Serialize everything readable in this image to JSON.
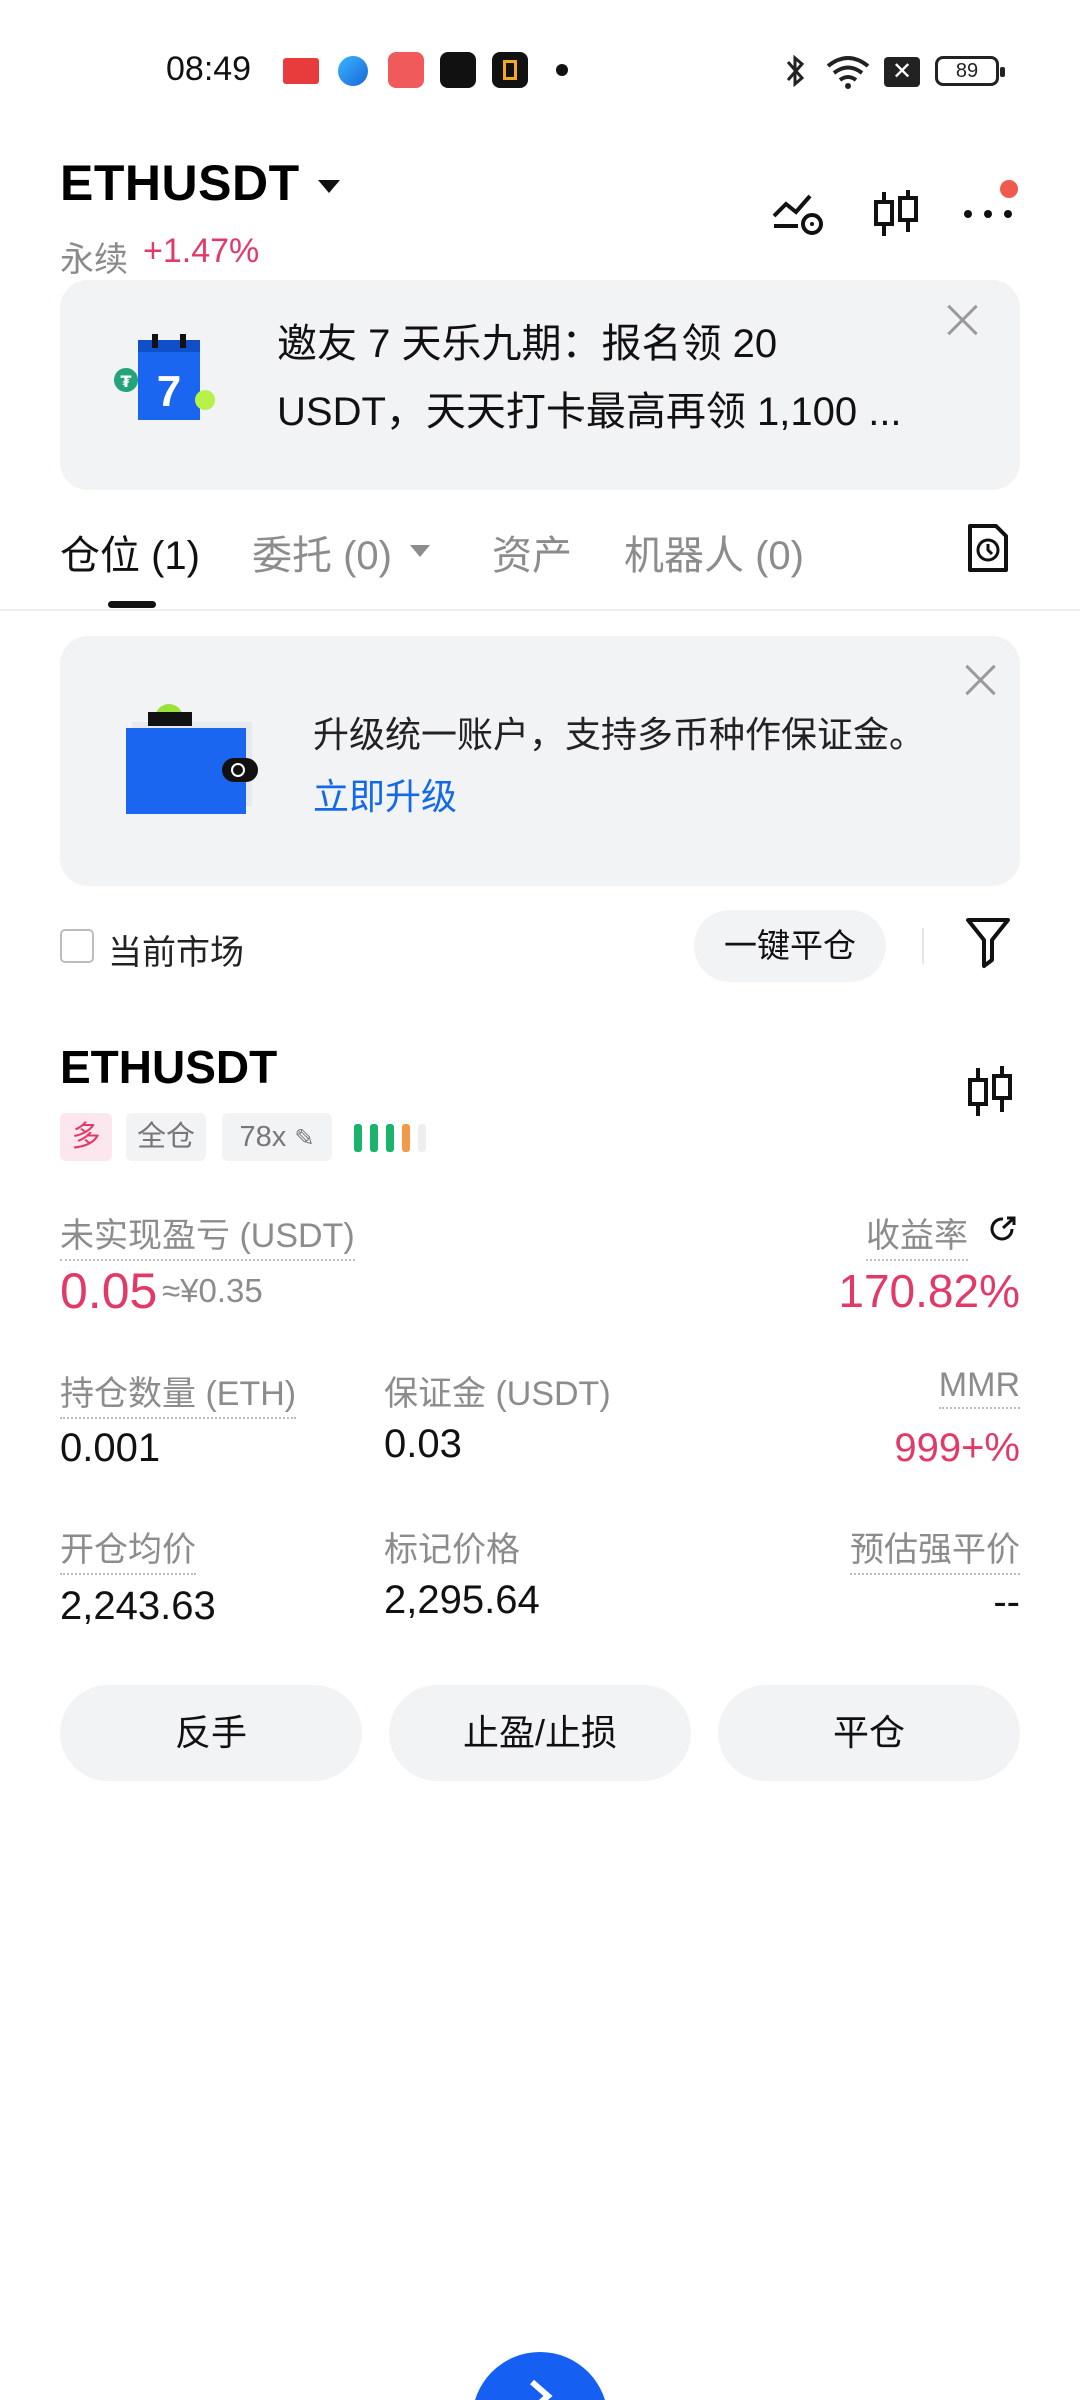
{
  "status_bar": {
    "time": "08:49",
    "battery": "89",
    "icons": [
      "toutiao-icon",
      "browser-icon",
      "video-app-icon",
      "tiktok-icon",
      "app-icon",
      "bluetooth-icon",
      "wifi-icon",
      "close-box-icon",
      "battery-icon"
    ]
  },
  "header": {
    "symbol": "ETHUSDT",
    "contract_type": "永续",
    "change": "+1.47%",
    "icons": [
      "trade-chart-icon",
      "candlestick-icon",
      "more-icon"
    ]
  },
  "promo_banner": {
    "text": "邀友 7 天乐九期：报名领 20 USDT，天天打卡最高再领 1,100 ...",
    "calendar_number": "7",
    "tether_symbol": "₮"
  },
  "tabs": [
    {
      "label": "仓位 (1)",
      "active": true
    },
    {
      "label": "委托 (0)",
      "active": false
    },
    {
      "label": "资产",
      "active": false
    },
    {
      "label": "机器人 (0)",
      "active": false
    }
  ],
  "upgrade_banner": {
    "text": "升级统一账户，支持多币种作保证金。",
    "link": "立即升级"
  },
  "filter": {
    "current_market_label": "当前市场",
    "close_all_label": "一键平仓"
  },
  "position": {
    "symbol": "ETHUSDT",
    "side": "多",
    "margin_mode": "全仓",
    "leverage": "78x",
    "unrealized_pnl_label": "未实现盈亏 (USDT)",
    "unrealized_pnl": "0.05",
    "unrealized_pnl_cny": "≈¥0.35",
    "roe_label": "收益率",
    "roe": "170.82%",
    "size_label": "持仓数量 (ETH)",
    "size": "0.001",
    "margin_label": "保证金 (USDT)",
    "margin": "0.03",
    "mmr_label": "MMR",
    "mmr": "999+%",
    "entry_price_label": "开仓均价",
    "entry_price": "2,243.63",
    "mark_price_label": "标记价格",
    "mark_price": "2,295.64",
    "liq_price_label": "预估强平价",
    "liq_price": "--"
  },
  "actions": {
    "reverse": "反手",
    "tp_sl": "止盈/止损",
    "close": "平仓"
  },
  "colors": {
    "positive": "#e23a68",
    "link": "#1469e8",
    "card_bg": "#f2f3f5",
    "risk_green": "#19b36b",
    "risk_orange": "#f2994a"
  }
}
